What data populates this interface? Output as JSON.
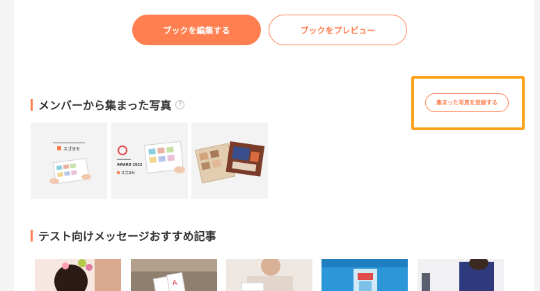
{
  "actions": {
    "edit_book": "ブックを編集する",
    "preview_book": "ブックをプレビュー"
  },
  "member_photos": {
    "title": "メンバーから集まった写真",
    "help": "?",
    "register_button": "集まった写真を登録する",
    "thumb1_brand": "スゴヨセ",
    "thumb2_brand": "スゴヨセ",
    "thumb2_award": "AWARD 2022"
  },
  "articles": {
    "title": "テスト向けメッセージおすすめ記事"
  },
  "colors": {
    "accent": "#ff7f50",
    "highlight": "#ffa21a"
  }
}
